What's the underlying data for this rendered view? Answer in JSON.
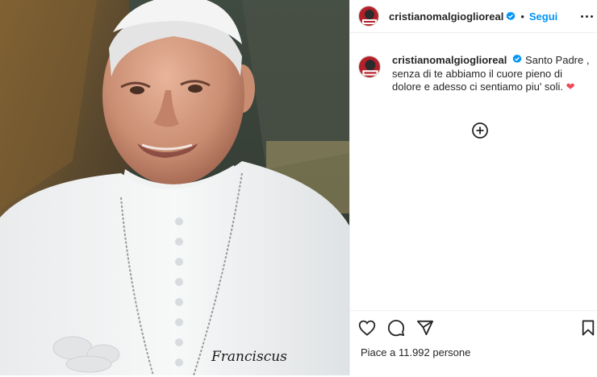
{
  "post": {
    "username": "cristianomalgioglioreal",
    "follow_label": "Segui",
    "separator": "•",
    "caption_text": "Santo Padre , senza di te abbiamo il cuore pieno di dolore e adesso ci sentiamo piu' soli.",
    "caption_emoji": "❤",
    "likes_text": "Piace a 11.992 persone",
    "photo_signature": "Franciscus"
  },
  "colors": {
    "follow_blue": "#0095f6",
    "verified_blue": "#0095f6",
    "heart_red": "#ed4956",
    "border": "#efefef"
  },
  "icons": {
    "like": "heart-outline-icon",
    "comment": "comment-bubble-icon",
    "share": "paper-plane-icon",
    "save": "bookmark-icon",
    "load_more": "plus-circle-icon",
    "options": "more-horizontal-icon"
  }
}
